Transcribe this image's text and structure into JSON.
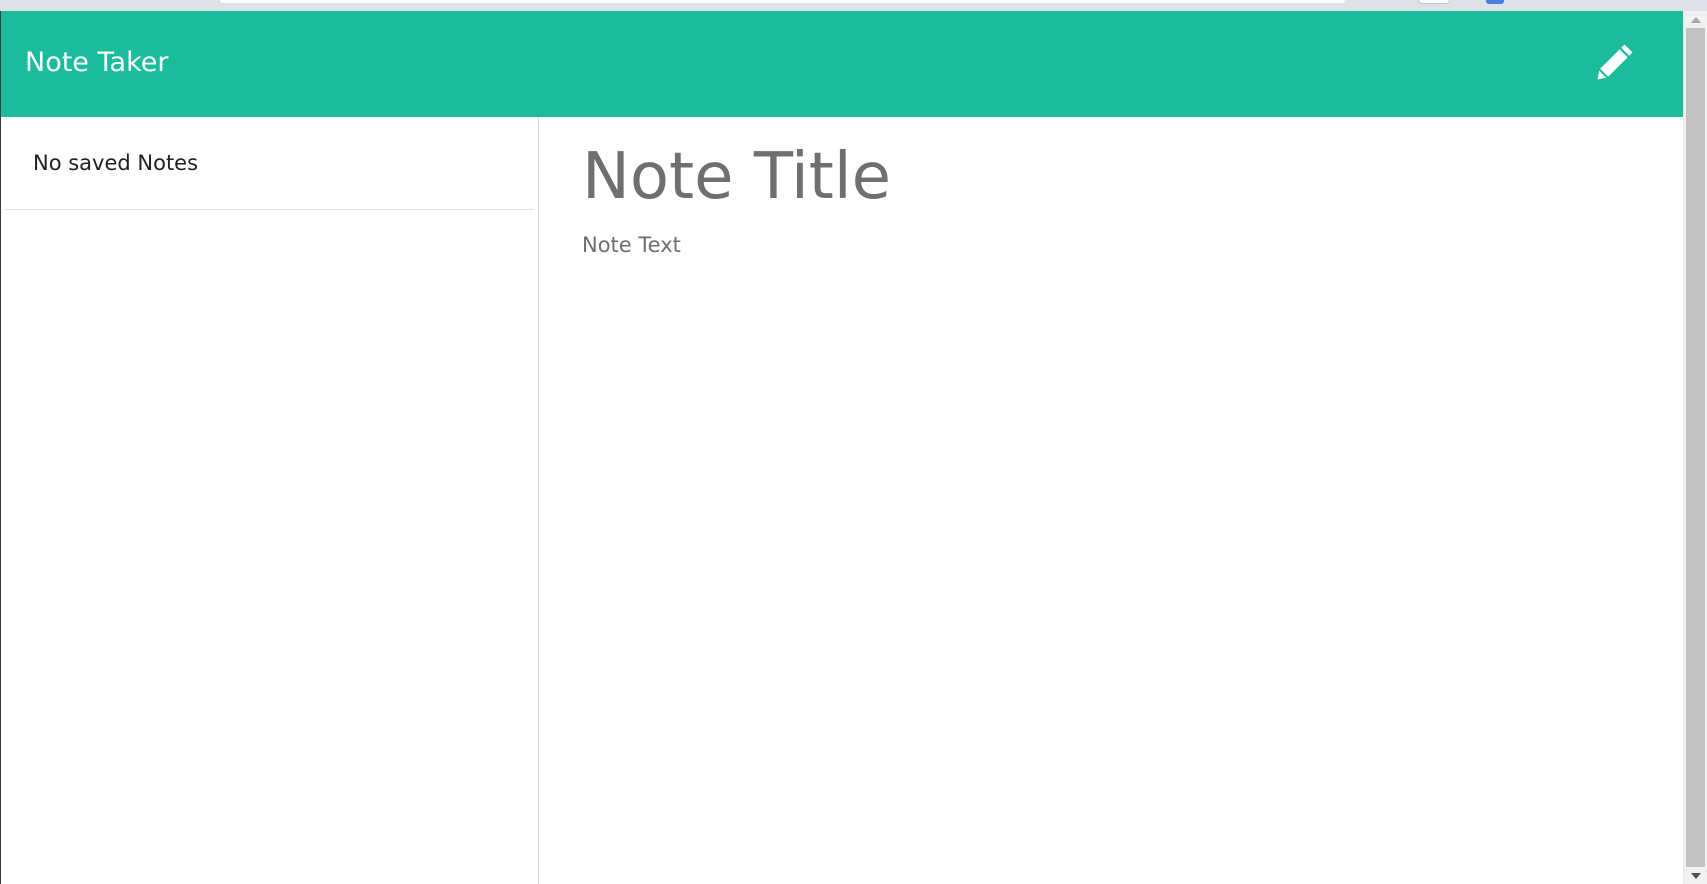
{
  "navbar": {
    "brand": "Note Taker",
    "background": "#1abc9c",
    "new_note_icon": "pencil-icon"
  },
  "sidebar": {
    "empty_message": "No saved Notes"
  },
  "editor": {
    "title_placeholder": "Note Title",
    "text_placeholder": "Note Text",
    "title_value": "",
    "text_value": ""
  },
  "scrollbar": {
    "up_icon": "caret-up-icon",
    "down_icon": "caret-down-icon"
  }
}
